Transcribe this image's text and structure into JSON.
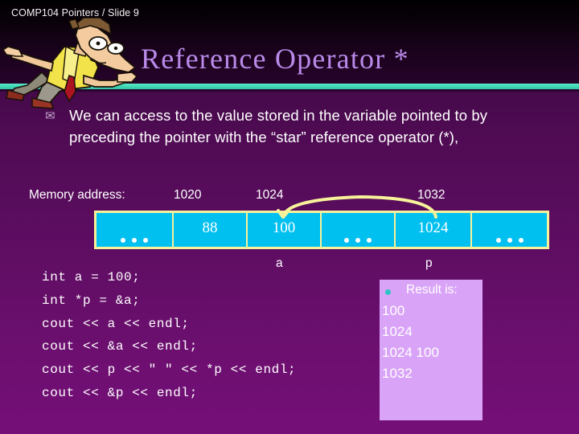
{
  "header": {
    "course_label": "COMP104 Pointers / Slide 9",
    "title": "Reference Operator  *"
  },
  "bullet": {
    "marker_icon": "envelope-bullet-icon",
    "text": "We can access to the value stored in the variable pointed to by preceding the pointer with the “star” reference operator (*),"
  },
  "memory": {
    "caption": "Memory address:",
    "addresses": [
      "1020",
      "1024",
      "1032"
    ],
    "cells": [
      {
        "value": "",
        "dots": true
      },
      {
        "value": "88",
        "dots": false
      },
      {
        "value": "100",
        "dots": false
      },
      {
        "value": "",
        "dots": true
      },
      {
        "value": "1024",
        "dots": false
      },
      {
        "value": "",
        "dots": true
      }
    ],
    "var_labels": {
      "a": "a",
      "p": "p"
    },
    "pointer_arc_icon": "pointer-arc-icon",
    "cell_fill": "#00c0f0",
    "cell_border": "#f7f29a"
  },
  "code": {
    "lines": [
      "int a = 100;",
      "int *p = &a;",
      "cout << a << endl;",
      "cout << &a << endl;",
      "cout << p << \" \" << *p << endl;",
      "cout << &p << endl;"
    ]
  },
  "result": {
    "bullet_icon": "round-bullet-icon",
    "title": "Result is:",
    "lines": [
      "100",
      "1024",
      "1024 100",
      "1032"
    ],
    "panel_color": "#d9a4f7"
  },
  "theme": {
    "title_color": "#b98ae8",
    "rule_color": "#3fd9b6",
    "background_top": "#2d0430",
    "background_bottom": "#750f78"
  }
}
